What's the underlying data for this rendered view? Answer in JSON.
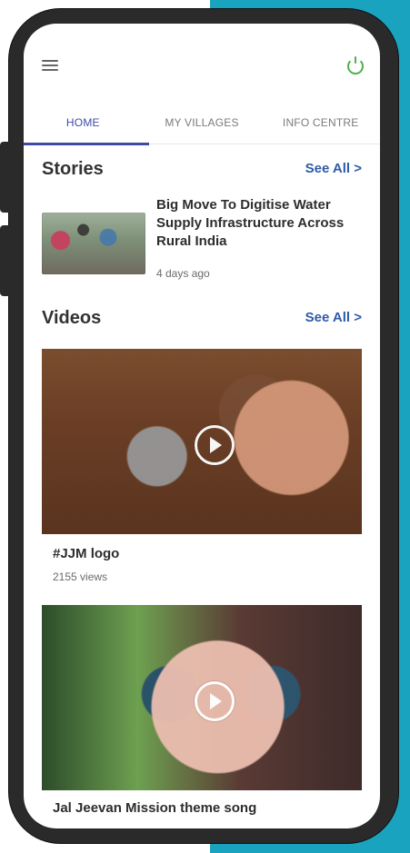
{
  "tabs": [
    {
      "label": "HOME",
      "active": true
    },
    {
      "label": "MY VILLAGES",
      "active": false
    },
    {
      "label": "INFO CENTRE",
      "active": false
    }
  ],
  "sections": {
    "stories": {
      "title": "Stories",
      "see_all": "See All >"
    },
    "videos": {
      "title": "Videos",
      "see_all": "See All >"
    }
  },
  "stories": [
    {
      "title": "Big Move To Digitise Water Supply Infrastructure Across Rural India",
      "time": "4 days ago"
    }
  ],
  "videos": [
    {
      "title": "#JJM logo",
      "views": "2155 views"
    },
    {
      "title": "Jal Jeevan Mission theme song",
      "views": ""
    }
  ],
  "icons": {
    "menu": "hamburger-menu-icon",
    "power": "power-icon",
    "play": "play-icon"
  },
  "colors": {
    "accent": "#3f4aa6",
    "see_all": "#2f5aa8",
    "status_green": "#4caf50",
    "background_teal": "#1aa3bf"
  }
}
